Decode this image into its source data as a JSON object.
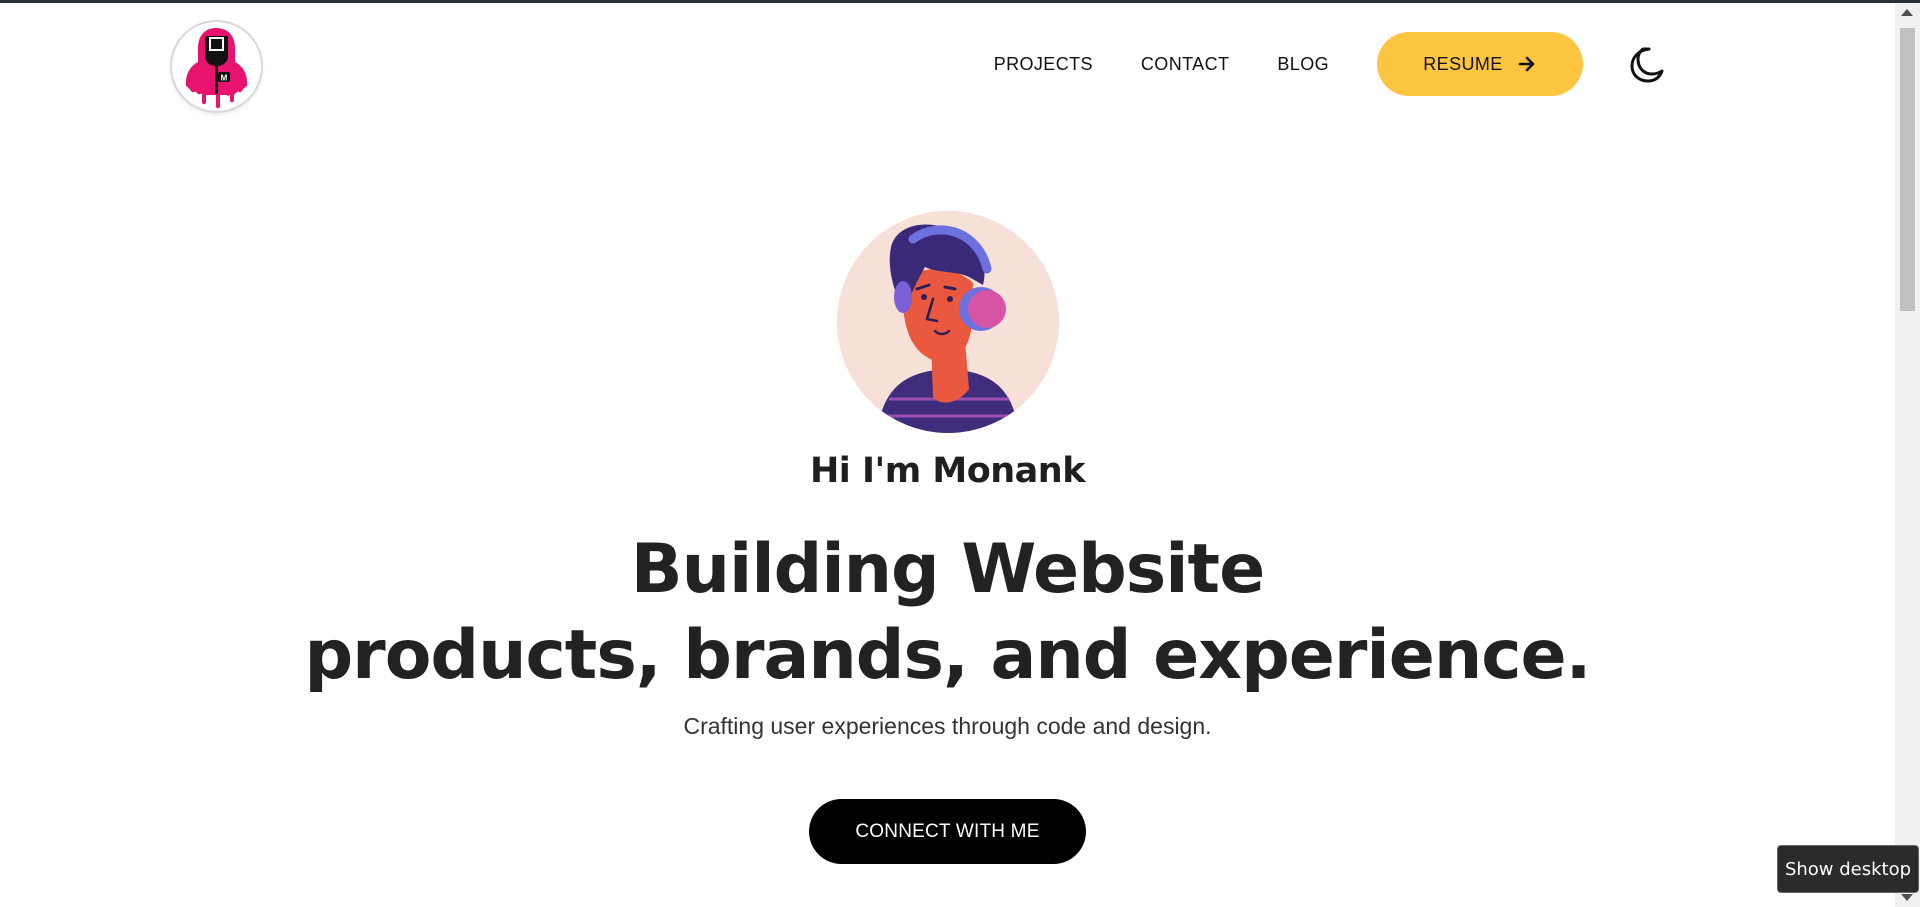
{
  "header": {
    "logo_icon": "hooded-figure-logo-icon",
    "nav_items": [
      {
        "label": "PROJECTS"
      },
      {
        "label": "CONTACT"
      },
      {
        "label": "BLOG"
      }
    ],
    "resume_label": "RESUME",
    "resume_icon": "arrow-right-icon",
    "theme_toggle_icon": "moon-icon"
  },
  "hero": {
    "avatar_icon": "avatar-with-headphones-icon",
    "greeting": "Hi I'm Monank",
    "headline_line1": "Building Website",
    "headline_line2": "products, brands, and experience.",
    "subtitle": "Crafting user experiences through code and design.",
    "cta_label": "CONNECT WITH ME"
  },
  "tooltip": {
    "text": "Show desktop"
  },
  "colors": {
    "accent": "#fdc540",
    "cta_background": "#000000",
    "avatar_background": "#f6e0d8",
    "logo_pink": "#e8136f"
  }
}
